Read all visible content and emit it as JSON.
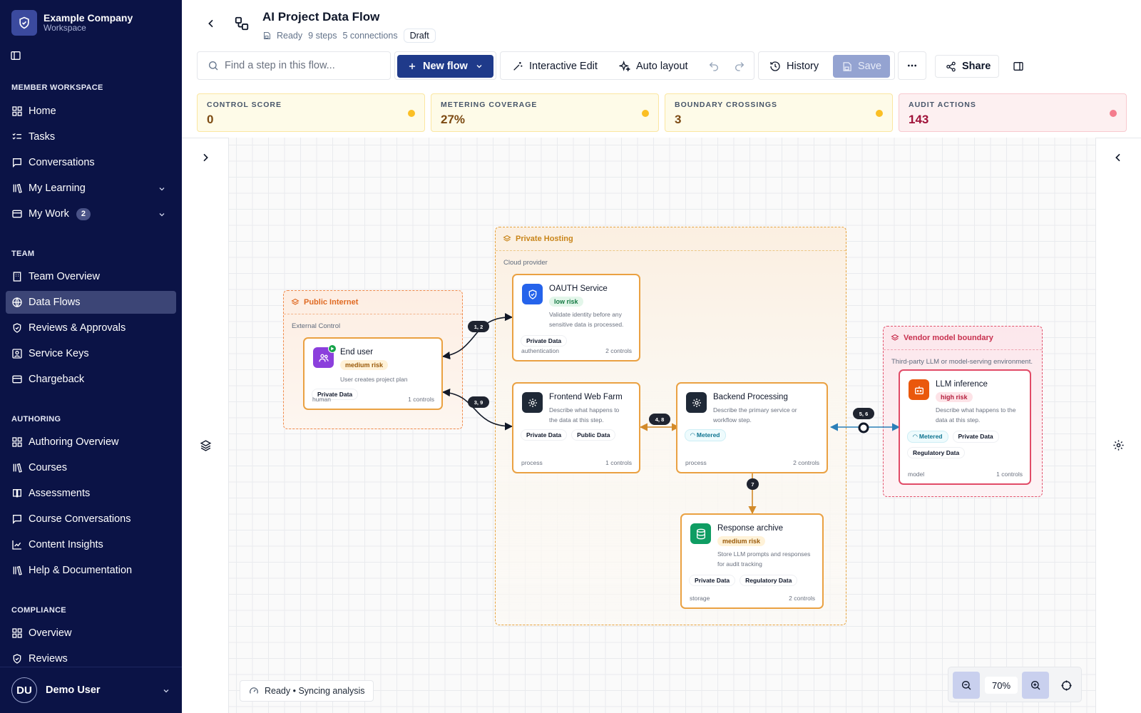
{
  "sidebar": {
    "brand_name": "Example Company",
    "brand_sub": "Workspace",
    "sections": {
      "member": "MEMBER WORKSPACE",
      "team": "TEAM",
      "authoring": "AUTHORING",
      "compliance": "COMPLIANCE"
    },
    "items": {
      "home": "Home",
      "tasks": "Tasks",
      "conversations": "Conversations",
      "my_learning": "My Learning",
      "my_work": "My Work",
      "my_work_badge": "2",
      "team_overview": "Team Overview",
      "data_flows": "Data Flows",
      "reviews_approvals": "Reviews & Approvals",
      "service_keys": "Service Keys",
      "chargeback": "Chargeback",
      "authoring_overview": "Authoring Overview",
      "courses": "Courses",
      "assessments": "Assessments",
      "course_conversations": "Course Conversations",
      "content_insights": "Content Insights",
      "help_docs": "Help & Documentation",
      "compliance_overview": "Overview",
      "reviews": "Reviews"
    },
    "active_item": "Data Flows",
    "user_initials": "DU",
    "user_name": "Demo User"
  },
  "header": {
    "title": "AI Project Data Flow",
    "status": "Ready",
    "steps": "9 steps",
    "connections": "5 connections",
    "badge": "Draft"
  },
  "toolbar": {
    "search_placeholder": "Find a step in this flow...",
    "new_flow": "New flow",
    "interactive_edit": "Interactive Edit",
    "auto_layout": "Auto layout",
    "history": "History",
    "save": "Save",
    "share": "Share"
  },
  "metrics": [
    {
      "label": "CONTROL SCORE",
      "value": "0",
      "status": "warn"
    },
    {
      "label": "METERING COVERAGE",
      "value": "27%",
      "status": "warn"
    },
    {
      "label": "BOUNDARY CROSSINGS",
      "value": "3",
      "status": "warn"
    },
    {
      "label": "AUDIT ACTIONS",
      "value": "143",
      "status": "danger"
    }
  ],
  "groups": {
    "public": {
      "title": "Public Internet",
      "desc": "External Control"
    },
    "private": {
      "title": "Private Hosting",
      "desc": "Cloud provider"
    },
    "vendor": {
      "title": "Vendor model boundary",
      "desc": "Third-party LLM or model-serving environment."
    }
  },
  "nodes": {
    "end_user": {
      "title": "End user",
      "risk": "medium risk",
      "desc": "User creates project plan",
      "chips": [
        "Private Data"
      ],
      "type": "human",
      "controls": "1 controls"
    },
    "oauth": {
      "title": "OAUTH Service",
      "risk": "low risk",
      "desc1": "Validate identity before any",
      "desc2": "sensitive data is processed.",
      "chips": [
        "Private Data"
      ],
      "type": "authentication",
      "controls": "2 controls"
    },
    "frontend": {
      "title": "Frontend Web Farm",
      "desc1": "Describe what happens to",
      "desc2": "the data at this step.",
      "chips": [
        "Private Data",
        "Public Data"
      ],
      "type": "process",
      "controls": "1 controls"
    },
    "backend": {
      "title": "Backend Processing",
      "desc1": "Describe the primary service or",
      "desc2": "workflow step.",
      "chips": [
        "Metered"
      ],
      "type": "process",
      "controls": "2 controls"
    },
    "archive": {
      "title": "Response archive",
      "risk": "medium risk",
      "desc1": "Store LLM prompts and responses",
      "desc2": "for audit tracking",
      "chips": [
        "Private Data",
        "Regulatory Data"
      ],
      "type": "storage",
      "controls": "2 controls"
    },
    "llm": {
      "title": "LLM inference",
      "risk": "high risk",
      "desc1": "Describe what happens to the",
      "desc2": "data at this step.",
      "chips": [
        "Metered",
        "Private Data",
        "Regulatory Data"
      ],
      "type": "model",
      "controls": "1 controls"
    }
  },
  "edges": {
    "e12": "1, 2",
    "e39": "3, 9",
    "e48": "4, 8",
    "e56": "5, 6",
    "e7": "7"
  },
  "footer": {
    "status": "Ready • Syncing analysis",
    "zoom": "70%"
  },
  "colors": {
    "sidebar_bg": "#0b1346",
    "primary": "#1f3a8a",
    "warn": "#fbbf24",
    "danger": "#f47c8d",
    "node_border": "#eaa142",
    "vendor_border": "#e14b67",
    "edge_orange": "#d28a2a",
    "edge_blue": "#2b7fb8"
  }
}
